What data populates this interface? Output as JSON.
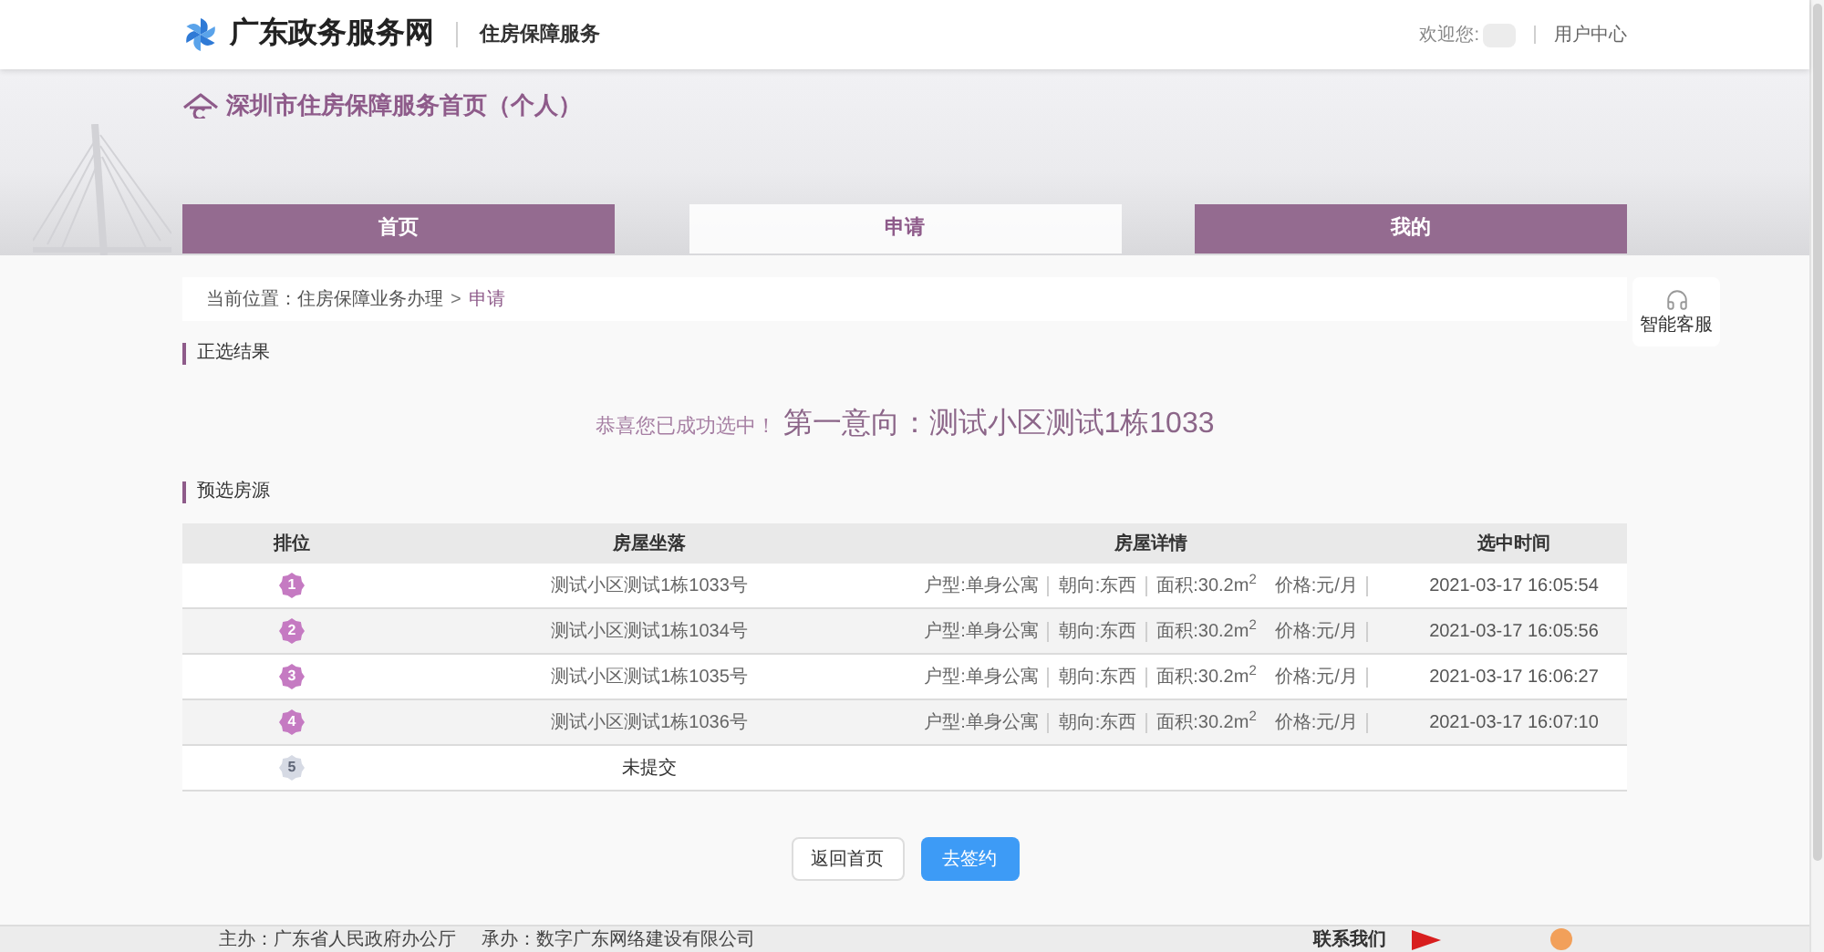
{
  "header": {
    "site_name": "广东政务服务网",
    "service_name": "住房保障服务",
    "welcome": "欢迎您:",
    "user_center": "用户中心"
  },
  "banner": {
    "title": "深圳市住房保障服务首页（个人）"
  },
  "tabs": [
    {
      "label": "首页",
      "selected": false
    },
    {
      "label": "申请",
      "selected": true
    },
    {
      "label": "我的",
      "selected": false
    }
  ],
  "breadcrumb": {
    "label": "当前位置：",
    "separator": ">",
    "items": [
      {
        "text": "住房保障业务办理",
        "current": false
      },
      {
        "text": "申请",
        "current": true
      }
    ]
  },
  "side_widget": {
    "label": "智能客服"
  },
  "result_section": {
    "title": "正选结果",
    "congrats": "恭喜您已成功选中！",
    "choice": "第一意向：测试小区测试1栋1033"
  },
  "preselect_section": {
    "title": "预选房源",
    "table": {
      "columns": [
        "排位",
        "房屋坐落",
        "房屋详情",
        "选中时间"
      ],
      "rows": [
        {
          "rank": "1",
          "submitted": true,
          "location": "测试小区测试1栋1033号",
          "details": [
            {
              "text": "户型:单身公寓",
              "divider_after": true
            },
            {
              "text": "朝向:东西",
              "divider_after": true
            },
            {
              "text": "面积:30.2m$^{2}$",
              "divider_after": false
            },
            {
              "text": "价格:元/月",
              "divider_after": true
            }
          ],
          "time": "2021-03-17 16:05:54"
        },
        {
          "rank": "2",
          "submitted": true,
          "location": "测试小区测试1栋1034号",
          "details": [
            {
              "text": "户型:单身公寓",
              "divider_after": true
            },
            {
              "text": "朝向:东西",
              "divider_after": true
            },
            {
              "text": "面积:30.2m$^{2}$",
              "divider_after": false
            },
            {
              "text": "价格:元/月",
              "divider_after": true
            }
          ],
          "time": "2021-03-17 16:05:56"
        },
        {
          "rank": "3",
          "submitted": true,
          "location": "测试小区测试1栋1035号",
          "details": [
            {
              "text": "户型:单身公寓",
              "divider_after": true
            },
            {
              "text": "朝向:东西",
              "divider_after": true
            },
            {
              "text": "面积:30.2m$^{2}$",
              "divider_after": false
            },
            {
              "text": "价格:元/月",
              "divider_after": true
            }
          ],
          "time": "2021-03-17 16:06:27"
        },
        {
          "rank": "4",
          "submitted": true,
          "location": "测试小区测试1栋1036号",
          "details": [
            {
              "text": "户型:单身公寓",
              "divider_after": true
            },
            {
              "text": "朝向:东西",
              "divider_after": true
            },
            {
              "text": "面积:30.2m$^{2}$",
              "divider_after": false
            },
            {
              "text": "价格:元/月",
              "divider_after": true
            }
          ],
          "time": "2021-03-17 16:07:10"
        },
        {
          "rank": "5",
          "submitted": false,
          "location": "未提交"
        }
      ]
    }
  },
  "buttons": [
    {
      "label": "返回首页",
      "kind": "secondary"
    },
    {
      "label": "去签约",
      "kind": "primary"
    }
  ],
  "footer": {
    "sponsor": "主办：广东省人民政府办公厅",
    "operator": "承办：数字广东网络建设有限公司",
    "contact": "联系我们"
  }
}
